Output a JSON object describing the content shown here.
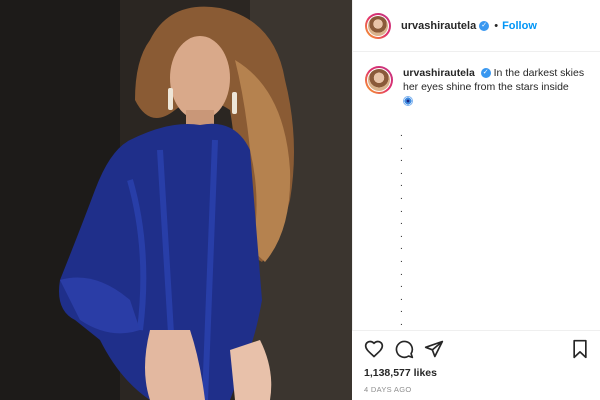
{
  "post": {
    "username": "urvashirautela",
    "verified_mark": "✓",
    "header_separator": "•",
    "follow_label": "Follow",
    "more_label": "•••",
    "caption_text": "In the darkest skies her eyes shine from the stars inside",
    "caption_emoji": "nazar-amulet-icon",
    "caption_dots": [
      ".",
      ".",
      ".",
      ".",
      ".",
      ".",
      ".",
      ".",
      ".",
      ".",
      ".",
      ".",
      ".",
      ".",
      ".",
      "."
    ],
    "likes": "1,138,577 likes",
    "timestamp": "4 DAYS AGO"
  },
  "icons": {
    "like": "heart-icon",
    "comment": "comment-icon",
    "share": "paper-plane-icon",
    "save": "bookmark-icon"
  },
  "colors": {
    "accent": "#0095f6",
    "verified": "#3897f0",
    "text": "#262626",
    "muted": "#8e8e8e"
  }
}
